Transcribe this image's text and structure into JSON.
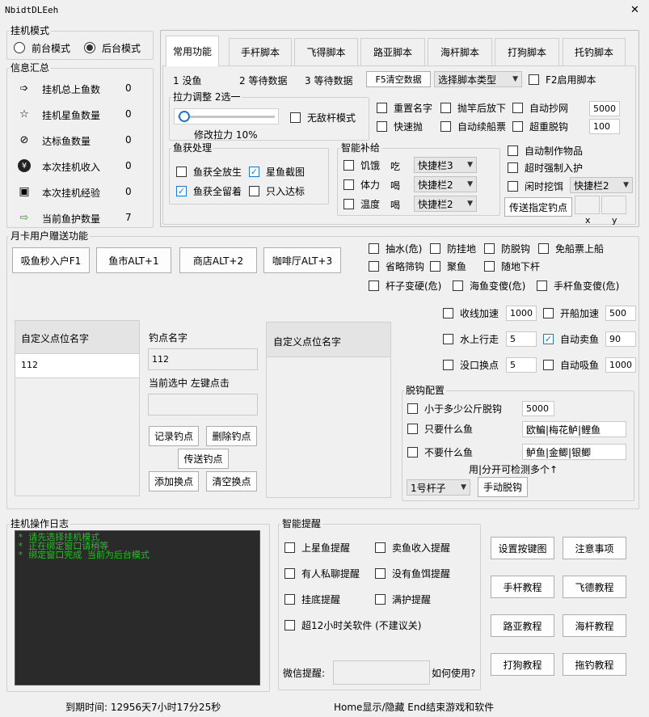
{
  "window": {
    "title": "NbidtDLEeh",
    "close": "✕"
  },
  "mode": {
    "label": "挂机模式",
    "front": "前台模式",
    "back": "后台模式",
    "selected": "back"
  },
  "summary": {
    "label": "信息汇总",
    "rows": [
      {
        "label": "挂机总上鱼数",
        "value": "0",
        "icon": "arrow-right-icon"
      },
      {
        "label": "挂机星鱼数量",
        "value": "0",
        "icon": "star-icon"
      },
      {
        "label": "达标鱼数量",
        "value": "0",
        "icon": "check-circle-icon"
      },
      {
        "label": "本次挂机收入",
        "value": "0",
        "icon": "yen-icon"
      },
      {
        "label": "本次挂机经验",
        "value": "0",
        "icon": "gift-icon"
      },
      {
        "label": "当前鱼护数量",
        "value": "7",
        "icon": "forward-arrow-icon"
      }
    ]
  },
  "tabs": [
    "常用功能",
    "手杆脚本",
    "飞得脚本",
    "路亚脚本",
    "海杆脚本",
    "打狗脚本",
    "托钓脚本"
  ],
  "topline": {
    "l1": "1 没鱼",
    "l2": "2 等待数据",
    "l3": "3 等待数据",
    "f5": "F5清空数据",
    "script_select": "选择脚本类型",
    "f2": "F2启用脚本"
  },
  "pull": {
    "label": "拉力调整 2选一",
    "value_text": "修改拉力 10%",
    "fraction": 0.03,
    "invincible": "无敌杆模式"
  },
  "opts1": {
    "rename": "重置名字",
    "throw_down": "抛竿后放下",
    "auto_copy": "自动抄网",
    "auto_copy_val": "5000",
    "quick_throw": "快速抛",
    "auto_ticket": "自动续船票",
    "super_unhook": "超重脱钩",
    "super_unhook_val": "100"
  },
  "catch": {
    "label": "鱼获处理",
    "release_all": "鱼获全放生",
    "star_shot": "星鱼截图",
    "keep_all": "鱼获全留着",
    "only_target": "只入达标"
  },
  "smart": {
    "label": "智能补给",
    "hunger": "饥饿",
    "eat": "吃",
    "hunger_slot": "快捷栏3",
    "stamina": "体力",
    "drink": "喝",
    "stamina_slot": "快捷栏2",
    "temp": "温度",
    "drink2": "喝",
    "temp_slot": "快捷栏2"
  },
  "opts2": {
    "auto_make": "自动制作物品",
    "timeout_guard": "超时强制入护",
    "idle_bait": "闲时挖饵",
    "idle_slot": "快捷栏2",
    "send_point": "传送指定钓点",
    "x_label": "x",
    "y_label": "y"
  },
  "monthly": {
    "label": "月卡用户赠送功能",
    "btn1": "吸鱼秒入户F1",
    "btn2": "鱼市ALT+1",
    "btn3": "商店ALT+2",
    "btn4": "咖啡厅ALT+3"
  },
  "monthly_opts": {
    "a1": "抽水(危)",
    "a2": "防挂地",
    "a3": "防脱钩",
    "a4": "免船票上船",
    "b1": "省略筛钩",
    "b2": "聚鱼",
    "b3": "随地下杆",
    "c1": "杆子变硬(危)",
    "c2": "海鱼变傻(危)",
    "c3": "手杆鱼变傻(危)"
  },
  "speed": {
    "reel": "收线加速",
    "reel_val": "1000",
    "boat": "开船加速",
    "boat_val": "500",
    "water_walk": "水上行走",
    "water_val": "5",
    "auto_sell": "自动卖鱼",
    "auto_sell_val": "90",
    "no_catch": "没口换点",
    "no_catch_val": "5",
    "auto_absorb": "自动吸鱼",
    "auto_absorb_val": "1000"
  },
  "points": {
    "header": "自定义点位名字",
    "item": "112",
    "name_label": "钓点名字",
    "name_val": "112",
    "hint": "当前选中 左键点击",
    "record": "记录钓点",
    "delete": "删除钓点",
    "send": "传送钓点",
    "add": "添加换点",
    "clear": "清空换点",
    "header2": "自定义点位名字"
  },
  "unhook": {
    "label": "脱钩配置",
    "less_than": "小于多少公斤脱钩",
    "less_val": "5000",
    "only_fish": "只要什么鱼",
    "only_val": "欧鳊|梅花鲈|鲤鱼",
    "no_fish": "不要什么鱼",
    "no_val": "鲈鱼|金鲫|银鲫",
    "hint": "用|分开可检测多个↑",
    "rod_select": "1号杆子",
    "manual": "手动脱钩"
  },
  "log": {
    "label": "挂机操作日志",
    "lines": [
      "* 请先选择挂机模式",
      "* 正在绑定窗口请稍等",
      "* 绑定窗口完成 当前为后台模式"
    ]
  },
  "remind": {
    "label": "智能提醒",
    "star": "上星鱼提醒",
    "sell": "卖鱼收入提醒",
    "chat": "有人私聊提醒",
    "no_bait": "没有鱼饵提醒",
    "bottom": "挂底提醒",
    "full": "满护提醒",
    "shutdown": "超12小时关软件 (不建议关)",
    "wechat": "微信提醒:",
    "how": "如何使用?"
  },
  "help": {
    "b1": "设置按键图",
    "b2": "注意事项",
    "b3": "手杆教程",
    "b4": "飞德教程",
    "b5": "路亚教程",
    "b6": "海杆教程",
    "b7": "打狗教程",
    "b8": "拖钓教程"
  },
  "footer": {
    "expire": "到期时间: 12956天7小时17分25秒",
    "keys": "Home显示/隐藏 End结束游戏和软件"
  }
}
